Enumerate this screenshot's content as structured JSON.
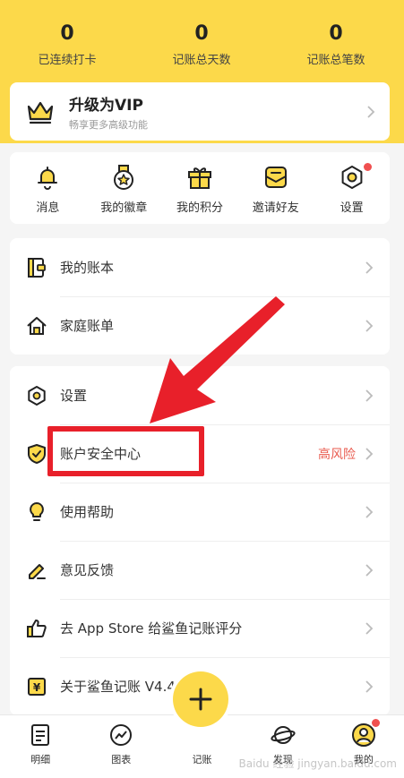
{
  "stats": [
    {
      "value": "0",
      "label": "已连续打卡"
    },
    {
      "value": "0",
      "label": "记账总天数"
    },
    {
      "value": "0",
      "label": "记账总笔数"
    }
  ],
  "vip": {
    "title": "升级为VIP",
    "subtitle": "畅享更多高级功能"
  },
  "shortcuts": [
    {
      "label": "消息",
      "icon": "bell-icon"
    },
    {
      "label": "我的徽章",
      "icon": "badge-icon"
    },
    {
      "label": "我的积分",
      "icon": "gift-icon"
    },
    {
      "label": "邀请好友",
      "icon": "envelope-icon"
    },
    {
      "label": "设置",
      "icon": "hexagon-settings-icon"
    }
  ],
  "menu_a": [
    {
      "label": "我的账本",
      "icon": "ledger-icon"
    },
    {
      "label": "家庭账单",
      "icon": "home-icon"
    }
  ],
  "menu_b": [
    {
      "label": "设置",
      "icon": "hexagon-settings-icon"
    },
    {
      "label": "账户安全中心",
      "icon": "shield-icon",
      "extra": "高风险"
    },
    {
      "label": "使用帮助",
      "icon": "lightbulb-icon"
    },
    {
      "label": "意见反馈",
      "icon": "pencil-icon"
    },
    {
      "label": "去 App Store 给鲨鱼记账评分",
      "icon": "thumbs-up-icon"
    },
    {
      "label": "关于鲨鱼记账 V4.40",
      "icon": "yen-icon"
    }
  ],
  "tabs": [
    {
      "label": "明细",
      "icon": "document-icon"
    },
    {
      "label": "图表",
      "icon": "chart-icon"
    },
    {
      "label": "记账",
      "icon": "plus-icon"
    },
    {
      "label": "发现",
      "icon": "planet-icon"
    },
    {
      "label": "我的",
      "icon": "profile-icon"
    }
  ],
  "watermark": "Baidu 经验 jingyan.baidu.com",
  "colors": {
    "accent": "#fcd94a",
    "alert": "#e95b4f",
    "annotation": "#e8202a"
  }
}
